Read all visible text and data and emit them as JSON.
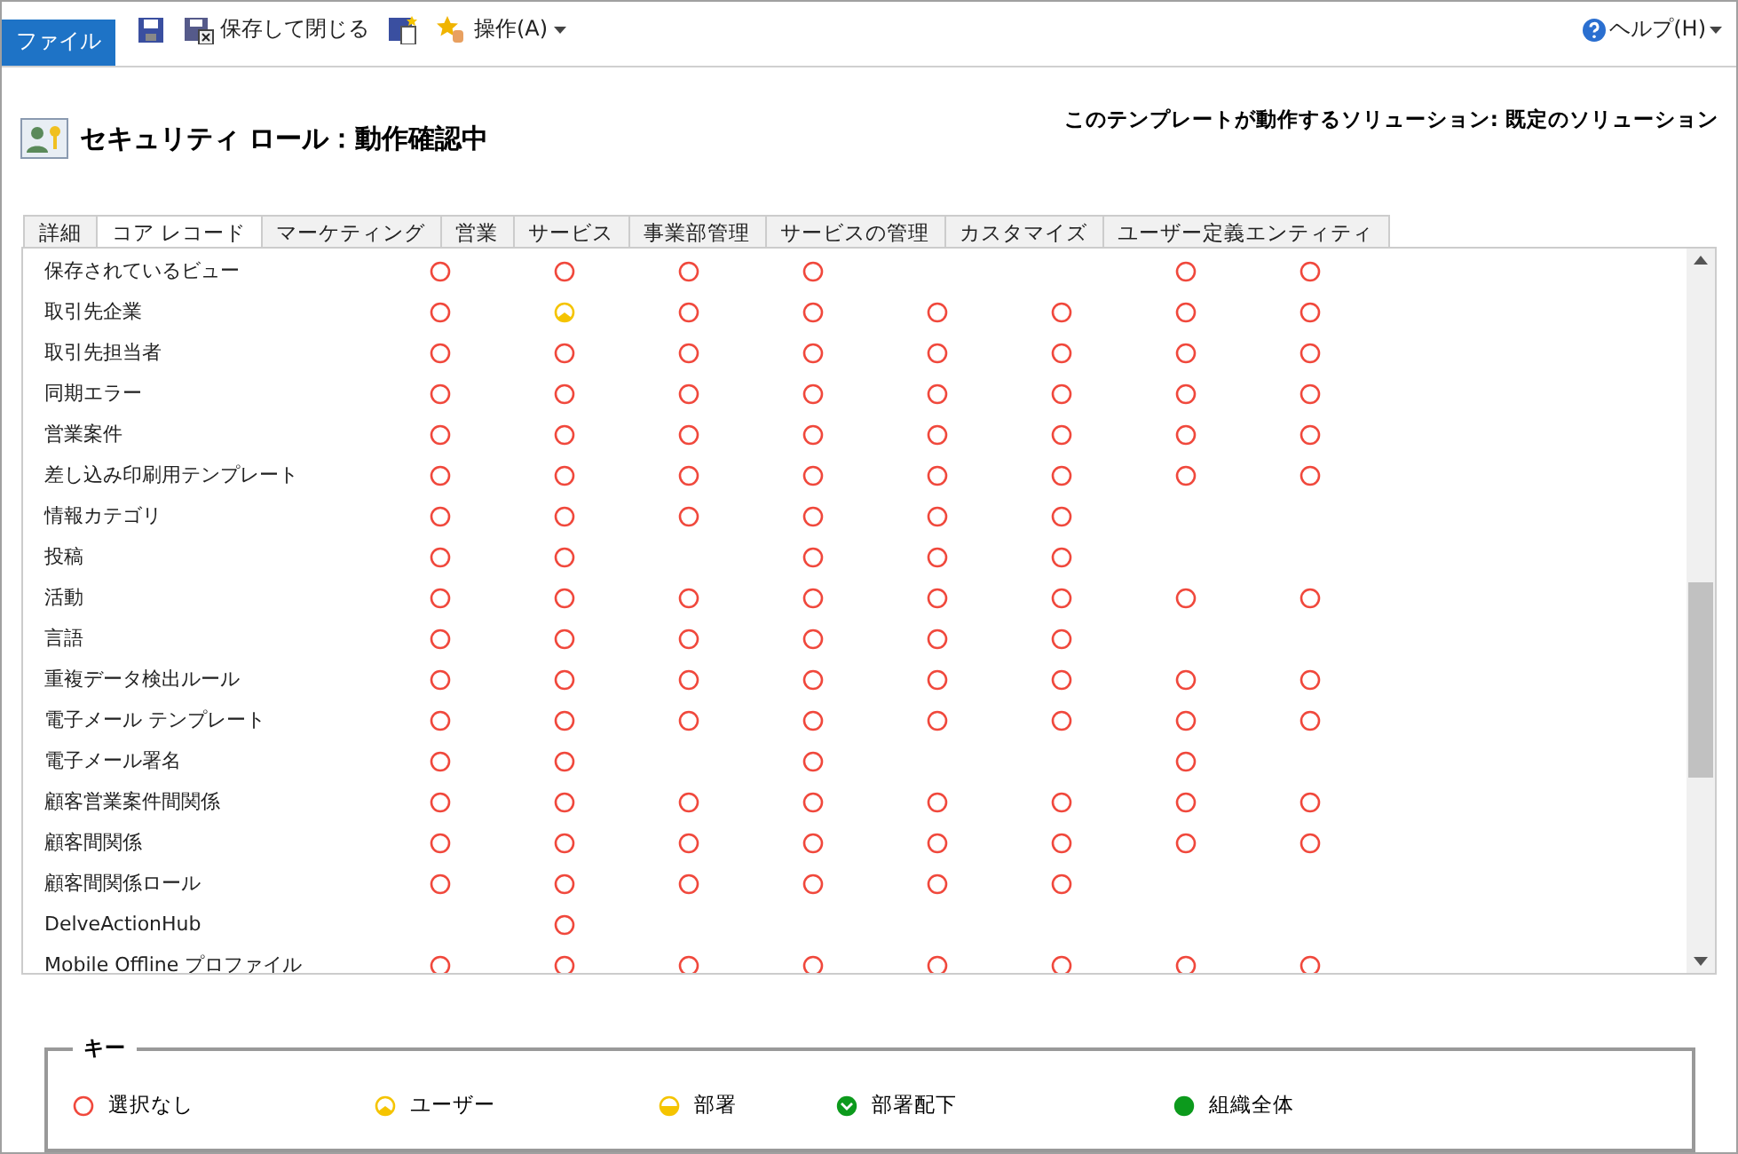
{
  "toolbar": {
    "file_tab": "ファイル",
    "save_close": "保存して閉じる",
    "actions": "操作(A)",
    "help": "ヘルプ(H)"
  },
  "header": {
    "title": "セキュリティ ロール：動作確認中",
    "solution": "このテンプレートが動作するソリューション: 既定のソリューション"
  },
  "tabs": [
    {
      "label": "詳細",
      "selected": false
    },
    {
      "label": "コア レコード",
      "selected": true
    },
    {
      "label": "マーケティング",
      "selected": false
    },
    {
      "label": "営業",
      "selected": false
    },
    {
      "label": "サービス",
      "selected": false
    },
    {
      "label": "事業部管理",
      "selected": false
    },
    {
      "label": "サービスの管理",
      "selected": false
    },
    {
      "label": "カスタマイズ",
      "selected": false
    },
    {
      "label": "ユーザー定義エンティティ",
      "selected": false
    }
  ],
  "rows": [
    {
      "name": "保存されているビュー",
      "cells": [
        {
          "kind": "none"
        },
        {
          "kind": "none"
        },
        {
          "kind": "none"
        },
        {
          "kind": "none"
        },
        null,
        null,
        {
          "kind": "none"
        },
        {
          "kind": "none"
        }
      ]
    },
    {
      "name": "取引先企業",
      "cells": [
        {
          "kind": "none"
        },
        {
          "kind": "user"
        },
        {
          "kind": "none"
        },
        {
          "kind": "none"
        },
        {
          "kind": "none"
        },
        {
          "kind": "none"
        },
        {
          "kind": "none"
        },
        {
          "kind": "none"
        }
      ]
    },
    {
      "name": "取引先担当者",
      "cells": [
        {
          "kind": "none"
        },
        {
          "kind": "none"
        },
        {
          "kind": "none"
        },
        {
          "kind": "none"
        },
        {
          "kind": "none"
        },
        {
          "kind": "none"
        },
        {
          "kind": "none"
        },
        {
          "kind": "none"
        }
      ]
    },
    {
      "name": "同期エラー",
      "cells": [
        {
          "kind": "none"
        },
        {
          "kind": "none"
        },
        {
          "kind": "none"
        },
        {
          "kind": "none"
        },
        {
          "kind": "none"
        },
        {
          "kind": "none"
        },
        {
          "kind": "none"
        },
        {
          "kind": "none"
        }
      ]
    },
    {
      "name": "営業案件",
      "cells": [
        {
          "kind": "none"
        },
        {
          "kind": "none"
        },
        {
          "kind": "none"
        },
        {
          "kind": "none"
        },
        {
          "kind": "none"
        },
        {
          "kind": "none"
        },
        {
          "kind": "none"
        },
        {
          "kind": "none"
        }
      ]
    },
    {
      "name": "差し込み印刷用テンプレート",
      "cells": [
        {
          "kind": "none"
        },
        {
          "kind": "none"
        },
        {
          "kind": "none"
        },
        {
          "kind": "none"
        },
        {
          "kind": "none"
        },
        {
          "kind": "none"
        },
        {
          "kind": "none"
        },
        {
          "kind": "none"
        }
      ]
    },
    {
      "name": "情報カテゴリ",
      "cells": [
        {
          "kind": "none"
        },
        {
          "kind": "none"
        },
        {
          "kind": "none"
        },
        {
          "kind": "none"
        },
        {
          "kind": "none"
        },
        {
          "kind": "none"
        },
        null,
        null
      ]
    },
    {
      "name": "投稿",
      "cells": [
        {
          "kind": "none"
        },
        {
          "kind": "none"
        },
        null,
        {
          "kind": "none"
        },
        {
          "kind": "none"
        },
        {
          "kind": "none"
        },
        null,
        null
      ]
    },
    {
      "name": "活動",
      "cells": [
        {
          "kind": "none"
        },
        {
          "kind": "none"
        },
        {
          "kind": "none"
        },
        {
          "kind": "none"
        },
        {
          "kind": "none"
        },
        {
          "kind": "none"
        },
        {
          "kind": "none"
        },
        {
          "kind": "none"
        }
      ]
    },
    {
      "name": "言語",
      "cells": [
        {
          "kind": "none"
        },
        {
          "kind": "none"
        },
        {
          "kind": "none"
        },
        {
          "kind": "none"
        },
        {
          "kind": "none"
        },
        {
          "kind": "none"
        },
        null,
        null
      ]
    },
    {
      "name": "重複データ検出ルール",
      "cells": [
        {
          "kind": "none"
        },
        {
          "kind": "none"
        },
        {
          "kind": "none"
        },
        {
          "kind": "none"
        },
        {
          "kind": "none"
        },
        {
          "kind": "none"
        },
        {
          "kind": "none"
        },
        {
          "kind": "none"
        }
      ]
    },
    {
      "name": "電子メール テンプレート",
      "cells": [
        {
          "kind": "none"
        },
        {
          "kind": "none"
        },
        {
          "kind": "none"
        },
        {
          "kind": "none"
        },
        {
          "kind": "none"
        },
        {
          "kind": "none"
        },
        {
          "kind": "none"
        },
        {
          "kind": "none"
        }
      ]
    },
    {
      "name": "電子メール署名",
      "cells": [
        {
          "kind": "none"
        },
        {
          "kind": "none"
        },
        null,
        {
          "kind": "none"
        },
        null,
        null,
        {
          "kind": "none"
        },
        null
      ]
    },
    {
      "name": "顧客営業案件間関係",
      "cells": [
        {
          "kind": "none"
        },
        {
          "kind": "none"
        },
        {
          "kind": "none"
        },
        {
          "kind": "none"
        },
        {
          "kind": "none"
        },
        {
          "kind": "none"
        },
        {
          "kind": "none"
        },
        {
          "kind": "none"
        }
      ]
    },
    {
      "name": "顧客間関係",
      "cells": [
        {
          "kind": "none"
        },
        {
          "kind": "none"
        },
        {
          "kind": "none"
        },
        {
          "kind": "none"
        },
        {
          "kind": "none"
        },
        {
          "kind": "none"
        },
        {
          "kind": "none"
        },
        {
          "kind": "none"
        }
      ]
    },
    {
      "name": "顧客間関係ロール",
      "cells": [
        {
          "kind": "none"
        },
        {
          "kind": "none"
        },
        {
          "kind": "none"
        },
        {
          "kind": "none"
        },
        {
          "kind": "none"
        },
        {
          "kind": "none"
        },
        null,
        null
      ]
    },
    {
      "name": "DelveActionHub",
      "cells": [
        null,
        {
          "kind": "none"
        },
        null,
        null,
        null,
        null,
        null,
        null
      ]
    },
    {
      "name": "Mobile Offline プロファイル",
      "cells": [
        {
          "kind": "none"
        },
        {
          "kind": "none"
        },
        {
          "kind": "none"
        },
        {
          "kind": "none"
        },
        {
          "kind": "none"
        },
        {
          "kind": "none"
        },
        {
          "kind": "none"
        },
        {
          "kind": "none"
        }
      ]
    }
  ],
  "key": {
    "title": "キー",
    "items": [
      {
        "kind": "none",
        "label": "選択なし"
      },
      {
        "kind": "user",
        "label": "ユーザー"
      },
      {
        "kind": "bu",
        "label": "部署"
      },
      {
        "kind": "child",
        "label": "部署配下"
      },
      {
        "kind": "org",
        "label": "組織全体"
      }
    ]
  }
}
